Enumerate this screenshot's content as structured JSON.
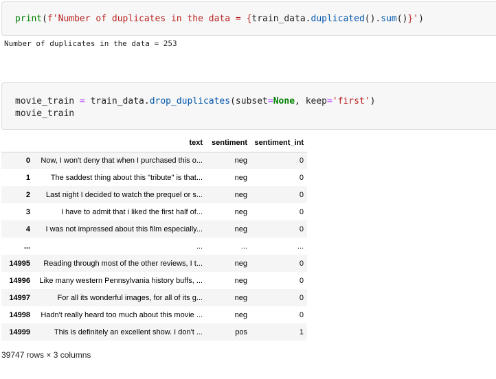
{
  "cell1": {
    "fn": "print",
    "open": "(",
    "str": "f'Number of duplicates in the data = ",
    "brace_open": "{",
    "obj": "train_data",
    "dot1": ".",
    "method1": "duplicated",
    "call1": "()",
    "dot2": ".",
    "method2": "sum",
    "call2": "()",
    "brace_close": "}",
    "str_end": "'",
    "close": ")"
  },
  "output1": "Number of duplicates in the data = 253",
  "cell2": {
    "lhs": "movie_train",
    "eq": " = ",
    "obj": "train_data",
    "dot": ".",
    "method": "drop_duplicates",
    "open": "(",
    "arg1": "subset",
    "eq1": "=",
    "val1": "None",
    "sep": ", ",
    "arg2": "keep",
    "eq2": "=",
    "val2": "'first'",
    "close": ")",
    "line2": "movie_train"
  },
  "dataframe": {
    "columns": [
      "text",
      "sentiment",
      "sentiment_int"
    ],
    "rows": [
      {
        "index": "0",
        "text": "Now, I won't deny that when I purchased this o...",
        "sentiment": "neg",
        "sentiment_int": "0"
      },
      {
        "index": "1",
        "text": "The saddest thing about this \"tribute\" is that...",
        "sentiment": "neg",
        "sentiment_int": "0"
      },
      {
        "index": "2",
        "text": "Last night I decided to watch the prequel or s...",
        "sentiment": "neg",
        "sentiment_int": "0"
      },
      {
        "index": "3",
        "text": "I have to admit that i liked the first half of...",
        "sentiment": "neg",
        "sentiment_int": "0"
      },
      {
        "index": "4",
        "text": "I was not impressed about this film especially...",
        "sentiment": "neg",
        "sentiment_int": "0"
      },
      {
        "index": "...",
        "text": "...",
        "sentiment": "...",
        "sentiment_int": "..."
      },
      {
        "index": "14995",
        "text": "Reading through most of the other reviews, I t...",
        "sentiment": "neg",
        "sentiment_int": "0"
      },
      {
        "index": "14996",
        "text": "Like many western Pennsylvania history buffs, ...",
        "sentiment": "neg",
        "sentiment_int": "0"
      },
      {
        "index": "14997",
        "text": "For all its wonderful images, for all of its g...",
        "sentiment": "neg",
        "sentiment_int": "0"
      },
      {
        "index": "14998",
        "text": "Hadn't really heard too much about this movie ...",
        "sentiment": "neg",
        "sentiment_int": "0"
      },
      {
        "index": "14999",
        "text": "This is definitely an excellent show. I don't ...",
        "sentiment": "pos",
        "sentiment_int": "1"
      }
    ],
    "shape": "39747 rows × 3 columns"
  }
}
